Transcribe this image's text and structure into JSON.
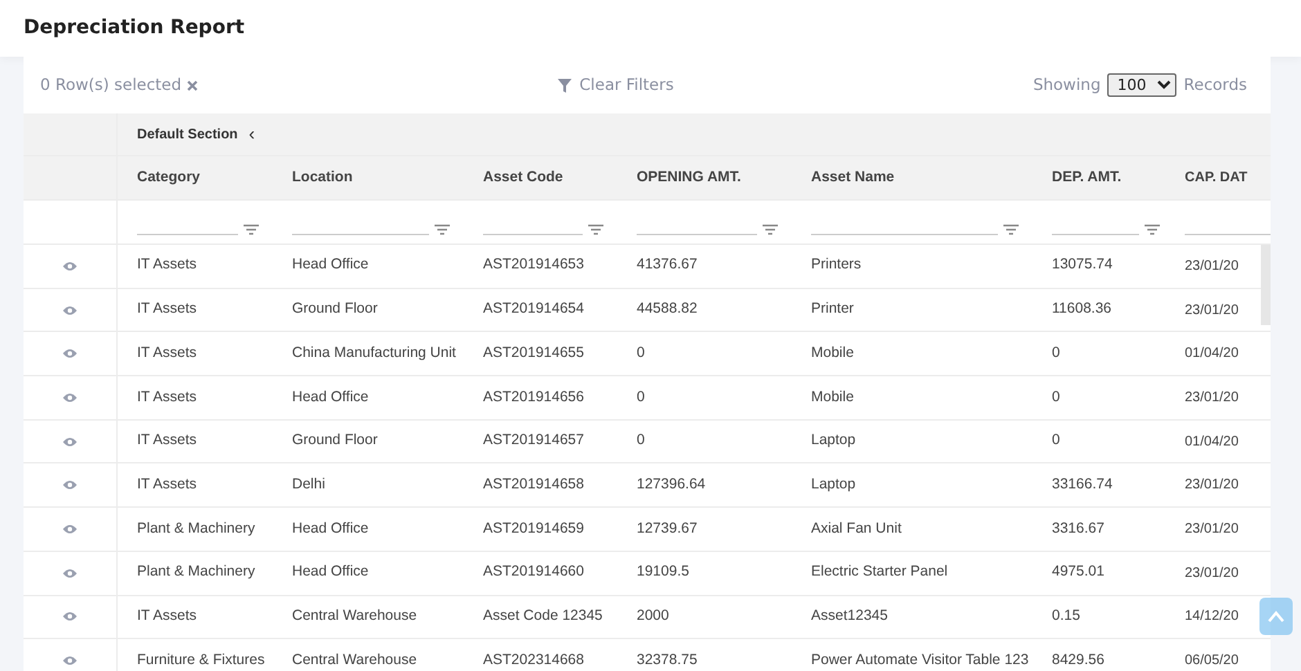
{
  "page": {
    "title": "Depreciation Report"
  },
  "toolbar": {
    "selection": "0 Row(s) selected",
    "clear_filters": "Clear Filters",
    "showing": "Showing",
    "page_size": "100",
    "records": "Records"
  },
  "section": {
    "label": "Default Section",
    "collapse_icon": "‹"
  },
  "table": {
    "columns": [
      "Category",
      "Location",
      "Asset Code",
      "OPENING AMT.",
      "Asset Name",
      "DEP. AMT.",
      "CAP. DAT"
    ],
    "rows": [
      {
        "cells": [
          "IT Assets",
          "Head Office",
          "AST201914653",
          "41376.67",
          "Printers",
          "13075.74",
          "23/01/20"
        ]
      },
      {
        "cells": [
          "IT Assets",
          "Ground Floor",
          "AST201914654",
          "44588.82",
          "Printer",
          "11608.36",
          "23/01/20"
        ]
      },
      {
        "cells": [
          "IT Assets",
          "China Manufacturing Unit",
          "AST201914655",
          "0",
          "Mobile",
          "0",
          "01/04/20"
        ]
      },
      {
        "cells": [
          "IT Assets",
          "Head Office",
          "AST201914656",
          "0",
          "Mobile",
          "0",
          "23/01/20"
        ]
      },
      {
        "cells": [
          "IT Assets",
          "Ground Floor",
          "AST201914657",
          "0",
          "Laptop",
          "0",
          "01/04/20"
        ]
      },
      {
        "cells": [
          "IT Assets",
          "Delhi",
          "AST201914658",
          "127396.64",
          "Laptop",
          "33166.74",
          "23/01/20"
        ]
      },
      {
        "cells": [
          "Plant & Machinery",
          "Head Office",
          "AST201914659",
          "12739.67",
          "Axial Fan Unit",
          "3316.67",
          "23/01/20"
        ]
      },
      {
        "cells": [
          "Plant & Machinery",
          "Head Office",
          "AST201914660",
          "19109.5",
          "Electric Starter Panel",
          "4975.01",
          "23/01/20"
        ]
      },
      {
        "cells": [
          "IT Assets",
          "Central Warehouse",
          "Asset Code 12345",
          "2000",
          "Asset12345",
          "0.15",
          "14/12/20"
        ]
      },
      {
        "cells": [
          "Furniture & Fixtures",
          "Central Warehouse",
          "AST202314668",
          "32378.75",
          "Power Automate Visitor Table 123",
          "8429.56",
          "06/05/20"
        ]
      }
    ]
  }
}
